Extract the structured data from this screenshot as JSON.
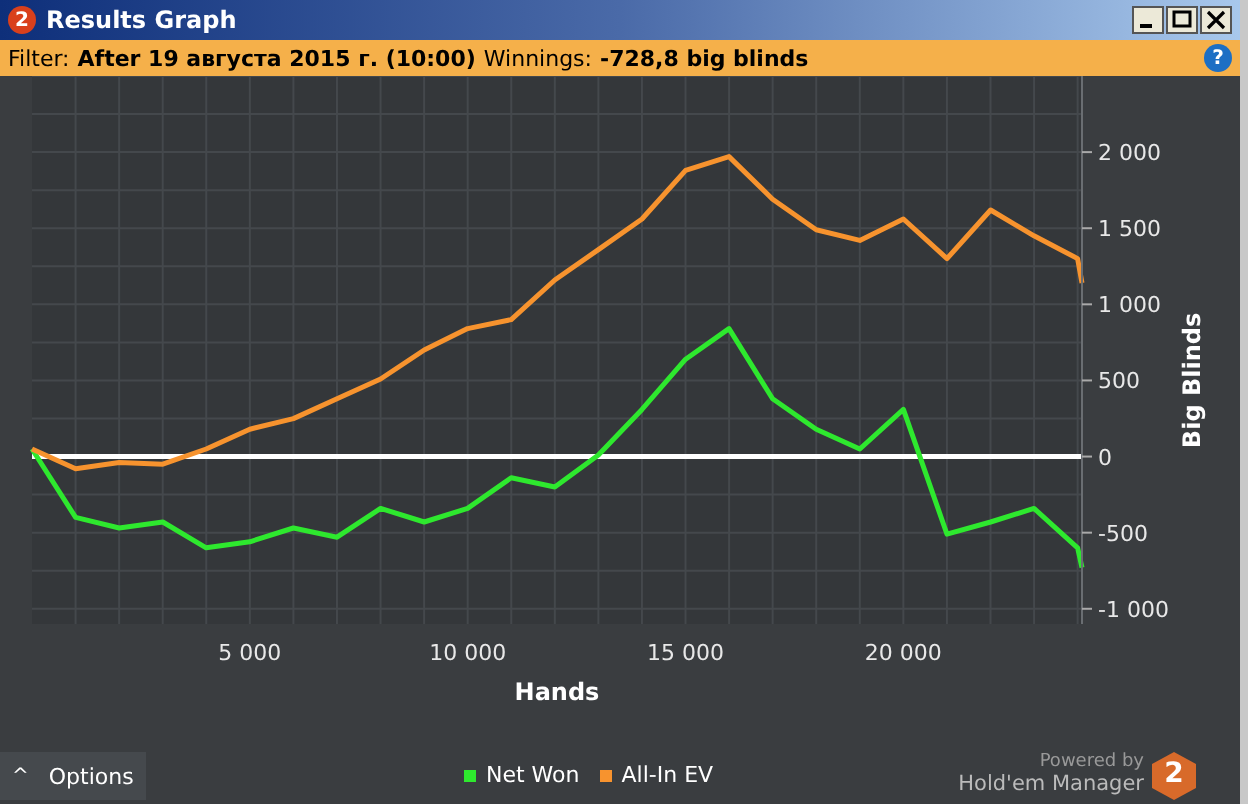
{
  "window": {
    "logo": "2",
    "title": "Results Graph"
  },
  "filter_bar": {
    "label": "Filter:",
    "filter": "After 19 августа 2015 г. (10:00)",
    "winnings_label": "Winnings:",
    "winnings": "-728,8 big blinds",
    "help": "?"
  },
  "chart": {
    "chart_data": {
      "type": "line",
      "xlabel": "Hands",
      "ylabel": "Big Blinds",
      "x": [
        0,
        1000,
        2000,
        3000,
        4000,
        5000,
        6000,
        7000,
        8000,
        9000,
        10000,
        11000,
        12000,
        13000,
        14000,
        15000,
        16000,
        17000,
        18000,
        19000,
        20000,
        21000,
        22000,
        23000,
        24000,
        24100
      ],
      "series": [
        {
          "name": "Net Won",
          "color": "#2ee82e",
          "values": [
            50,
            -400,
            -470,
            -430,
            -600,
            -560,
            -470,
            -530,
            -340,
            -430,
            -340,
            -140,
            -200,
            10,
            310,
            640,
            840,
            380,
            180,
            50,
            310,
            -510,
            -430,
            -340,
            -600,
            -730
          ]
        },
        {
          "name": "All-In EV",
          "color": "#f7932e",
          "values": [
            50,
            -80,
            -40,
            -50,
            50,
            180,
            250,
            380,
            510,
            700,
            840,
            900,
            1160,
            1360,
            1560,
            1880,
            1970,
            1690,
            1490,
            1420,
            1560,
            1300,
            1620,
            1450,
            1300,
            1140
          ]
        }
      ],
      "grid": true,
      "xlim": [
        0,
        24100
      ],
      "ylim": [
        -1100,
        2500
      ],
      "xticks": [
        {
          "value": 5000,
          "label": "5 000"
        },
        {
          "value": 10000,
          "label": "10 000"
        },
        {
          "value": 15000,
          "label": "15 000"
        },
        {
          "value": 20000,
          "label": "20 000"
        }
      ],
      "yticks": [
        {
          "value": -1000,
          "label": "-1 000"
        },
        {
          "value": -500,
          "label": "-500"
        },
        {
          "value": 0,
          "label": "0"
        },
        {
          "value": 500,
          "label": "500"
        },
        {
          "value": 1000,
          "label": "1 000"
        },
        {
          "value": 1500,
          "label": "1 500"
        },
        {
          "value": 2000,
          "label": "2 000"
        }
      ]
    }
  },
  "footer": {
    "options": {
      "caret": "^",
      "label": "Options"
    },
    "powered_by": "Powered by",
    "product": "Hold'em Manager",
    "logo": "2"
  }
}
